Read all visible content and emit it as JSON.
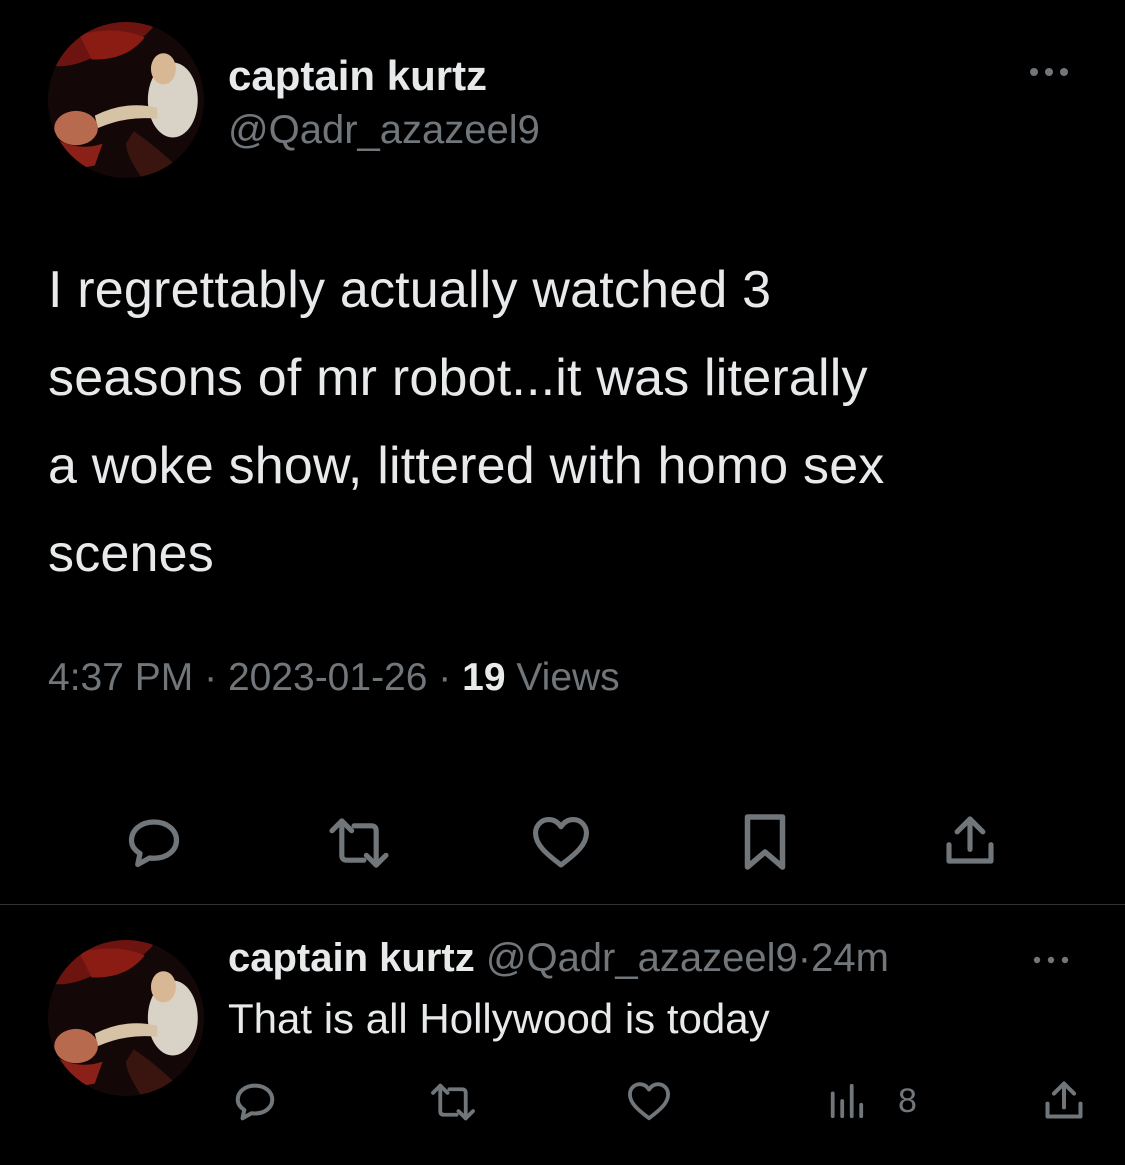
{
  "tweet": {
    "author": {
      "display_name": "captain kurtz",
      "handle": "@Qadr_azazeel9"
    },
    "text_lines": [
      "I regrettably actually watched 3",
      "seasons of mr robot...it was literally",
      "a woke show, littered with homo sex",
      "scenes"
    ],
    "time": "4:37 PM",
    "separator": "·",
    "date": "2023-01-26",
    "views_count": "19",
    "views_label": "Views",
    "actions": [
      "reply-icon",
      "retweet-icon",
      "like-icon",
      "bookmark-icon",
      "share-icon"
    ]
  },
  "reply": {
    "author": {
      "display_name": "captain kurtz",
      "handle": "@Qadr_azazeel9"
    },
    "separator": "·",
    "age": "24m",
    "text": "That is all Hollywood is today",
    "views_count": "8",
    "actions": [
      "reply-icon",
      "retweet-icon",
      "like-icon",
      "views-icon",
      "share-icon"
    ]
  },
  "colors": {
    "background": "#000000",
    "primary_text": "#e7e9ea",
    "secondary_text": "#71767b",
    "divider": "#2f3336"
  }
}
